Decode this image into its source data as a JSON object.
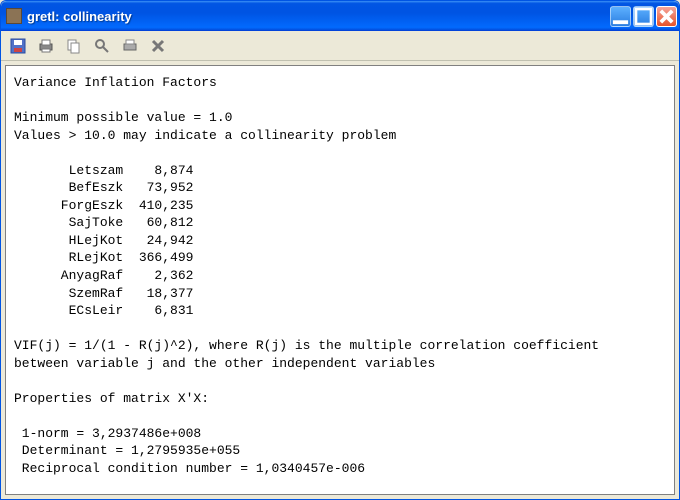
{
  "window": {
    "title": "gretl: collinearity"
  },
  "report": {
    "heading": "Variance Inflation Factors",
    "minLine": "Minimum possible value = 1.0",
    "warnLine": "Values > 10.0 may indicate a collinearity problem",
    "vifRows": [
      {
        "name": "Letszam",
        "value": "8,874"
      },
      {
        "name": "BefEszk",
        "value": "73,952"
      },
      {
        "name": "ForgEszk",
        "value": "410,235"
      },
      {
        "name": "SajToke",
        "value": "60,812"
      },
      {
        "name": "HLejKot",
        "value": "24,942"
      },
      {
        "name": "RLejKot",
        "value": "366,499"
      },
      {
        "name": "AnyagRaf",
        "value": "2,362"
      },
      {
        "name": "SzemRaf",
        "value": "18,377"
      },
      {
        "name": "ECsLeir",
        "value": "6,831"
      }
    ],
    "formula1": "VIF(j) = 1/(1 - R(j)^2), where R(j) is the multiple correlation coefficient",
    "formula2": "between variable j and the other independent variables",
    "propsHeading": "Properties of matrix X'X:",
    "oneNorm": " 1-norm = 3,2937486e+008",
    "det": " Determinant = 1,2795935e+055",
    "recip": " Reciprocal condition number = 1,0340457e-006"
  },
  "icons": {
    "app": "gretl-app-icon",
    "minimize": "minimize-icon",
    "maximize": "maximize-icon",
    "close": "close-icon",
    "save": "save-icon",
    "print": "print-icon",
    "copy": "copy-icon",
    "zoom": "zoom-icon",
    "pagesetup": "pagesetup-icon",
    "closeX": "toolbar-close-icon"
  }
}
